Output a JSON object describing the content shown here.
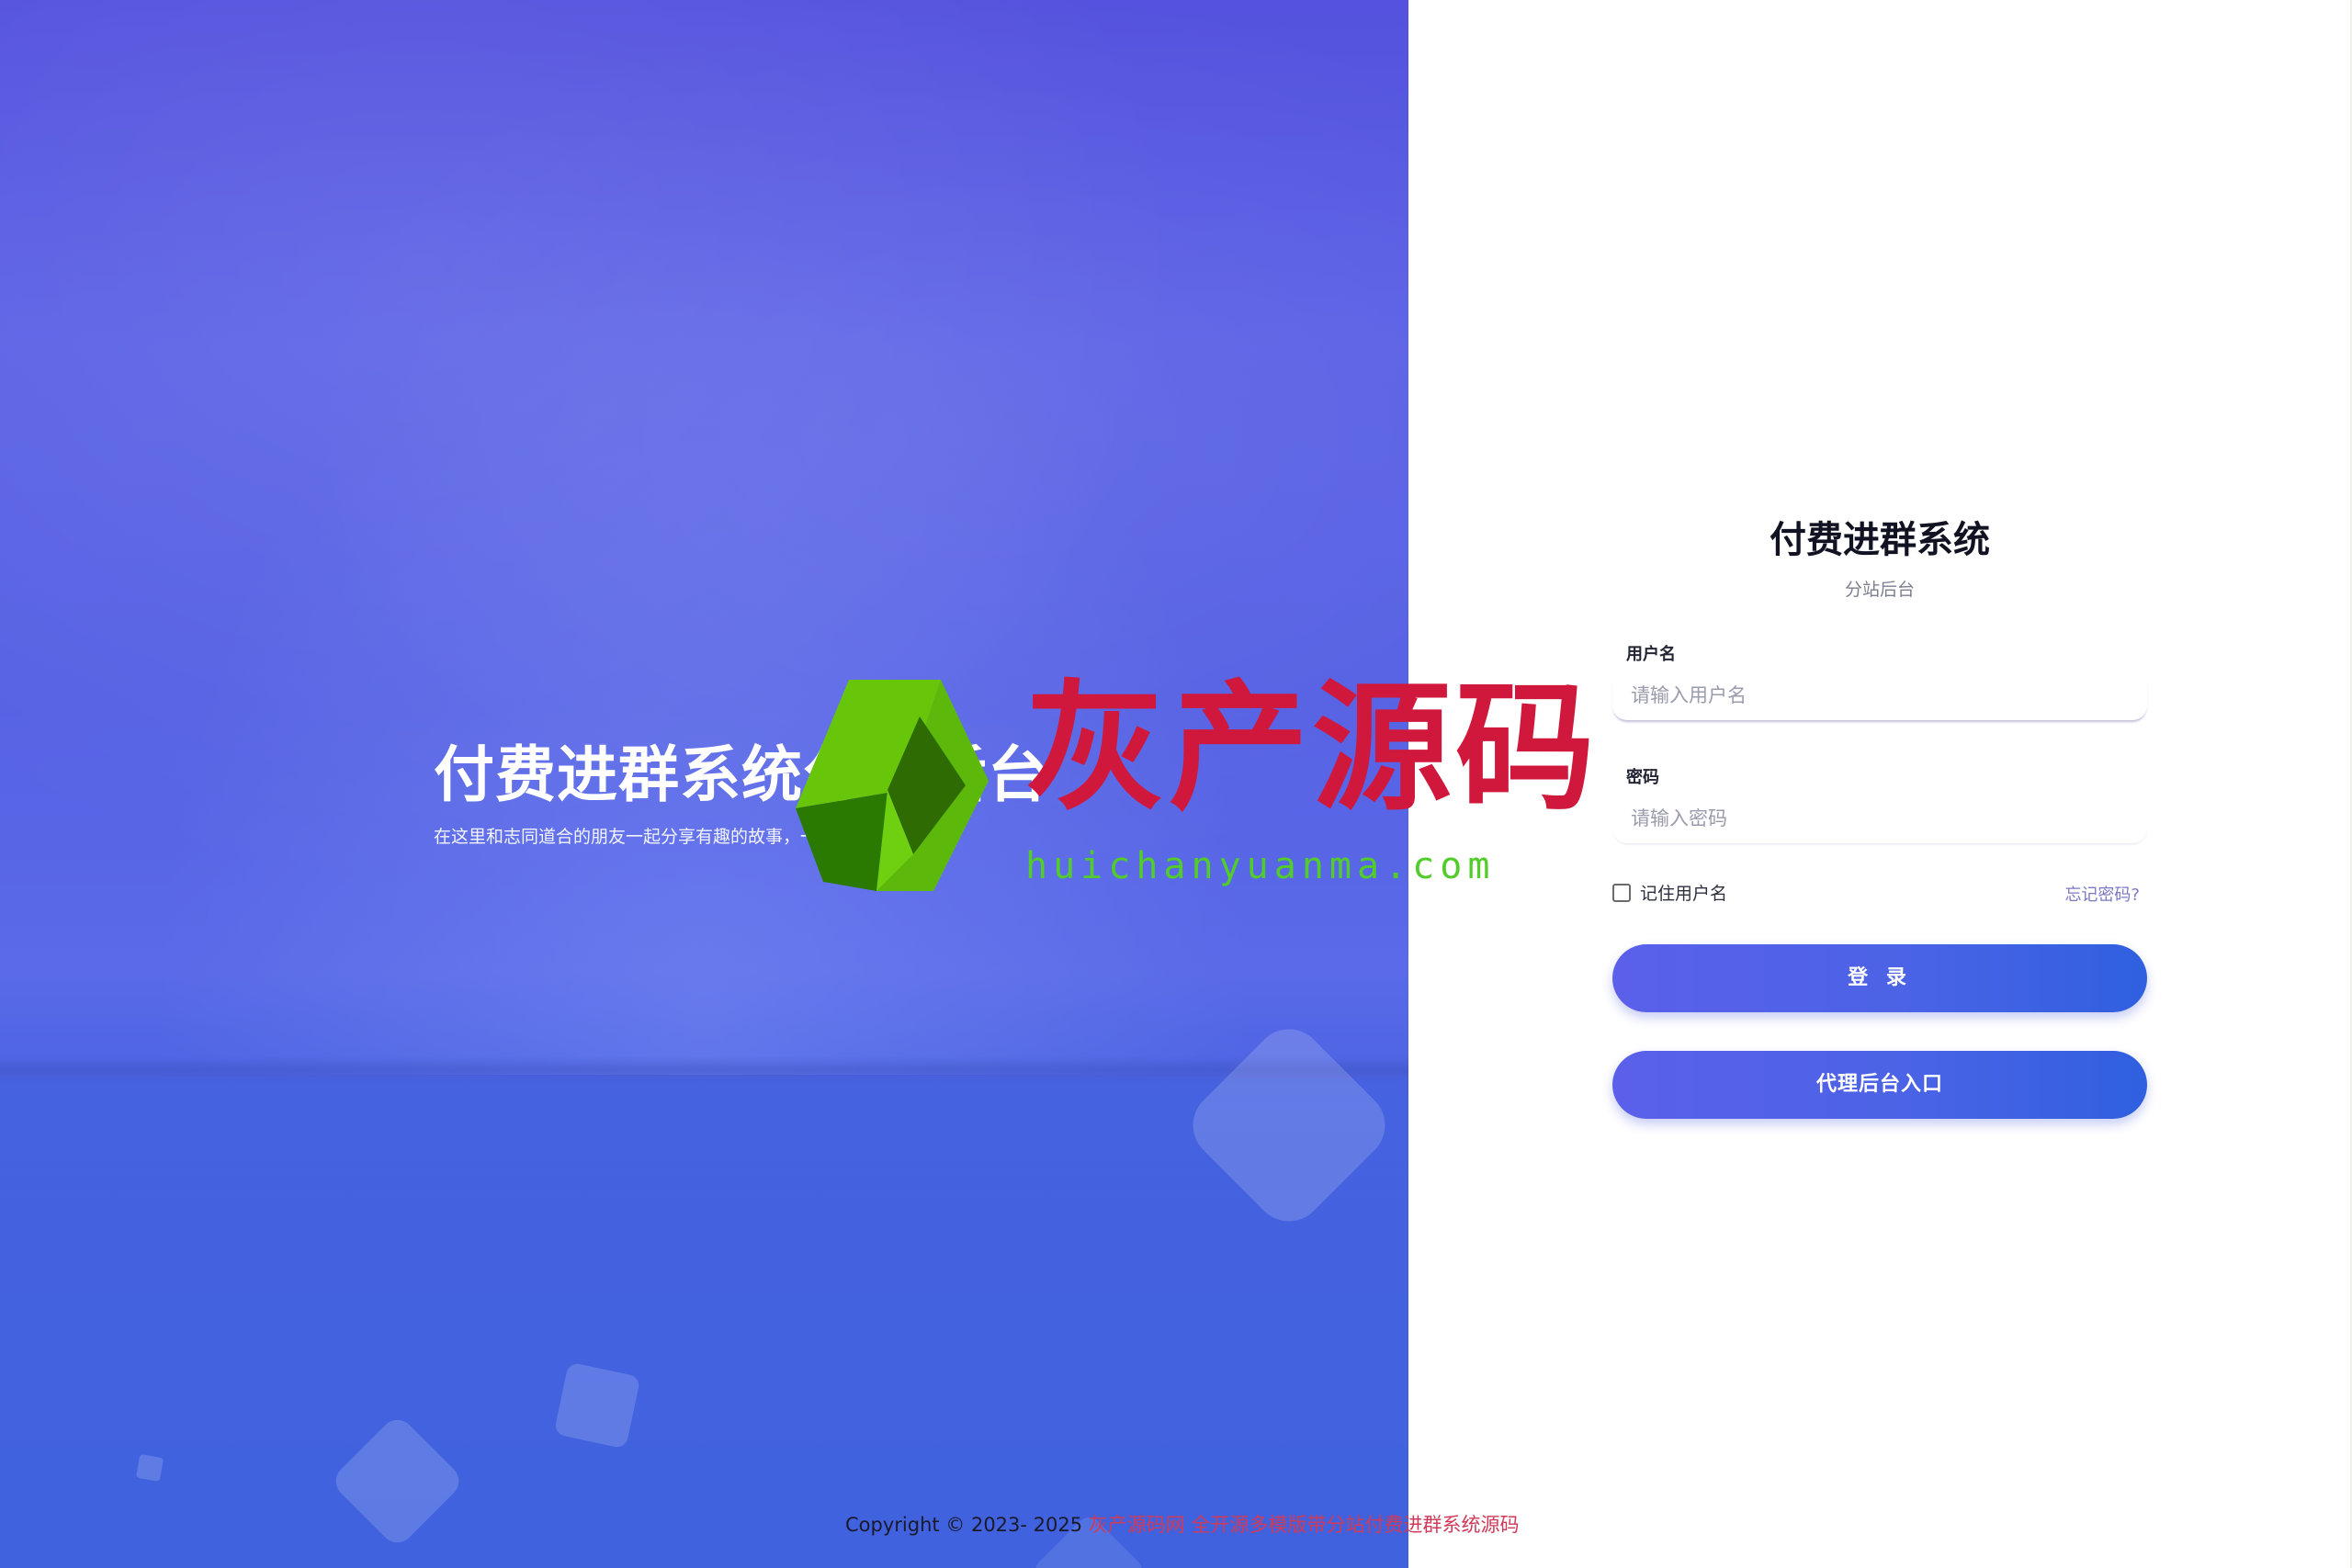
{
  "hero": {
    "title": "付费进群系统分站后台",
    "subtitle": "在这里和志同道合的朋友一起分享有趣的故事，一起探索有趣的系统"
  },
  "login": {
    "title": "付费进群系统",
    "subtitle": "分站后台",
    "username": {
      "label": "用户名",
      "placeholder": "请输入用户名",
      "value": ""
    },
    "password": {
      "label": "密码",
      "placeholder": "请输入密码",
      "value": ""
    },
    "remember_label": "记住用户名",
    "remember_checked": false,
    "forgot_label": "忘记密码?",
    "login_button": "登 录",
    "agent_button": "代理后台入口"
  },
  "watermark": {
    "text": "灰产源码",
    "url": "huichanyuanma.com"
  },
  "footer": {
    "copyright": "Copyright © 2023- 2025 ",
    "link_text": "灰产源码网 全开源多模版带分站付费进群系统源码"
  },
  "colors": {
    "hero_top": "#5452de",
    "hero_bottom": "#3f62de",
    "button_start": "#5b60ea",
    "button_end": "#2f60df",
    "watermark_red": "#d0173c",
    "watermark_green": "#52cc2a",
    "footer_link": "#cf3a58"
  }
}
